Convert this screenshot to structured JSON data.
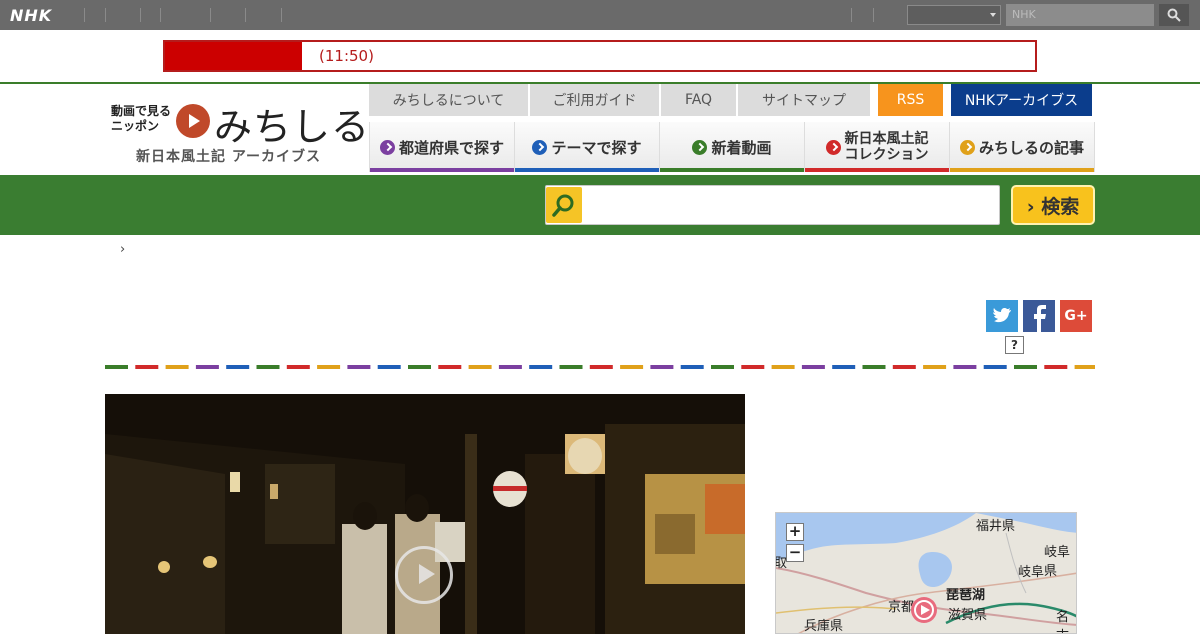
{
  "nhk_bar": {
    "logo": "NHK",
    "search_placeholder": "NHK"
  },
  "alert": {
    "text": "(11:50)"
  },
  "logo": {
    "line1": "動画で見る",
    "line2": "ニッポン",
    "title": "みちしる",
    "subtitle": "新日本風土記 アーカイブス"
  },
  "upper_nav": [
    {
      "label": "みちしるについて"
    },
    {
      "label": "ご利用ガイド"
    },
    {
      "label": "FAQ"
    },
    {
      "label": "サイトマップ"
    },
    {
      "label": "RSS"
    },
    {
      "label": "NHKアーカイブス"
    }
  ],
  "lower_nav": [
    {
      "label": "都道府県で探す",
      "color": "#7b3fa0"
    },
    {
      "label": "テーマで探す",
      "color": "#1f5fb8"
    },
    {
      "label": "新着動画",
      "color": "#3a7d2a"
    },
    {
      "label_line1": "新日本風土記",
      "label_line2": "コレクション",
      "color": "#d12a2a"
    },
    {
      "label": "みちしるの記事",
      "color": "#e0a11a"
    }
  ],
  "search": {
    "button_label": "› 検索",
    "icon": "search-icon"
  },
  "breadcrumb": {
    "separator": "›"
  },
  "social": {
    "twitter": "twitter-icon",
    "facebook": "facebook-icon",
    "google": "G+",
    "help": "?"
  },
  "colors": {
    "brand_green": "#3a7d31",
    "alert_red": "#cc0000",
    "rss_orange": "#f7941d",
    "archive_blue": "#0b3d8c"
  },
  "video": {
    "icon": "play-icon"
  },
  "map": {
    "zoom_in": "+",
    "zoom_out": "−",
    "labels": [
      "福井県",
      "岐阜県",
      "岐阜",
      "琵琶湖",
      "京都",
      "滋賀県",
      "名古",
      "兵庫県",
      "取"
    ]
  }
}
